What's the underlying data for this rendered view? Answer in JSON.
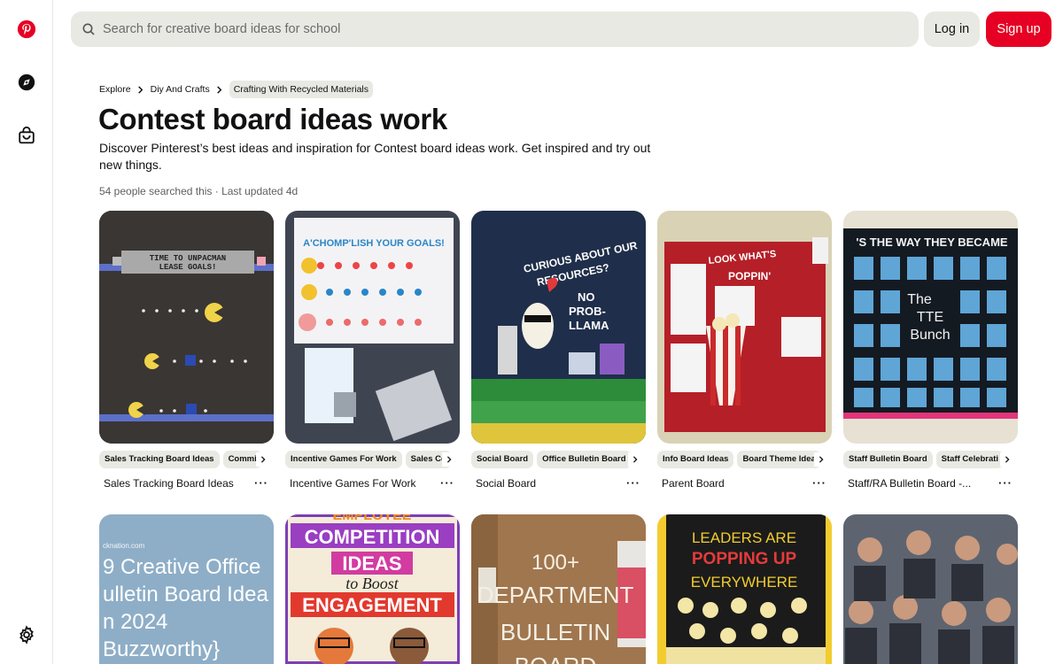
{
  "search": {
    "placeholder": "Search for creative board ideas for school"
  },
  "auth": {
    "login_label": "Log in",
    "signup_label": "Sign up"
  },
  "breadcrumb": {
    "items": [
      "Explore",
      "Diy And Crafts",
      "Crafting With Recycled Materials"
    ]
  },
  "page": {
    "title": "Contest board ideas work",
    "description": "Discover Pinterest’s best ideas and inspiration for Contest board ideas work. Get inspired and try out new things.",
    "meta": "54 people searched this · Last updated 4d"
  },
  "pins": [
    {
      "tags": [
        "Sales Tracking Board Ideas",
        "Commi"
      ],
      "title": "Sales Tracking Board Ideas",
      "image_text": [
        "TIME TO UNPACMAN",
        "LEASE GOALS!"
      ]
    },
    {
      "tags": [
        "Incentive Games For Work",
        "Sales Co"
      ],
      "title": "Incentive Games For Work",
      "image_text": [
        "A'CHOMP'LISH YOUR GOALS!"
      ]
    },
    {
      "tags": [
        "Social Board",
        "Office Bulletin Board"
      ],
      "title": "Social Board",
      "image_text": [
        "CURIOUS ABOUT OUR",
        "RESOURCES?",
        "NO",
        "PROB-",
        "LLAMA"
      ]
    },
    {
      "tags": [
        "Info Board Ideas",
        "Board Theme Idea"
      ],
      "title": "Parent Board",
      "image_text": [
        "LOOK WHAT'S",
        "POPPIN'"
      ]
    },
    {
      "tags": [
        "Staff Bulletin Board",
        "Staff Celebrati"
      ],
      "title": "Staff/RA Bulletin Board -...",
      "image_text": [
        "'S THE WAY THEY BECAME",
        "The",
        "TTE",
        "Bunch"
      ]
    }
  ],
  "pins_row2": [
    {
      "image_text": [
        "cknation.com",
        "9 Creative Office",
        "ulletin Board Idea",
        "n 2024",
        "Buzzworthy}"
      ]
    },
    {
      "image_text": [
        "EMPLOYEE",
        "COMPETITION",
        "IDEAS",
        "to Boost",
        "ENGAGEMENT"
      ]
    },
    {
      "image_text": [
        "100+",
        "DEPARTMENT",
        "BULLETIN",
        "BOARD"
      ]
    },
    {
      "image_text": [
        "LEADERS ARE",
        "POPPING UP",
        "EVERYWHERE"
      ]
    },
    {
      "image_text": []
    }
  ],
  "colors": {
    "brand": "#e60023",
    "chip": "#e9e9e3"
  },
  "icons": {
    "sidebar": [
      "pinterest-logo-icon",
      "explore-compass-icon",
      "shop-bag-icon",
      "settings-gear-icon"
    ],
    "search": "search-icon"
  }
}
